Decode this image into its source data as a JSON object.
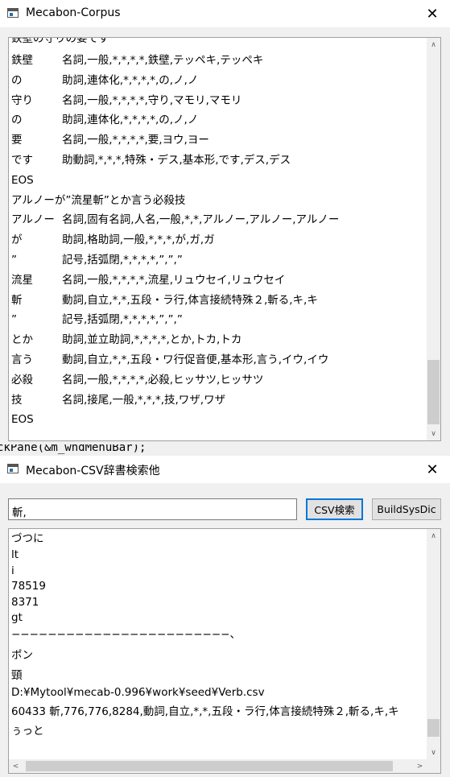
{
  "window1": {
    "title": "Mecabon-Corpus",
    "close_glyph": "✕",
    "first_line_partial": "鉄壁の守りの要です",
    "rows": [
      {
        "word": "鉄壁",
        "info": "名詞,一般,*,*,*,*,鉄壁,テッペキ,テッペキ"
      },
      {
        "word": "の",
        "info": "助詞,連体化,*,*,*,*,の,ノ,ノ"
      },
      {
        "word": "守り",
        "info": "名詞,一般,*,*,*,*,守り,マモリ,マモリ"
      },
      {
        "word": "の",
        "info": "助詞,連体化,*,*,*,*,の,ノ,ノ"
      },
      {
        "word": "要",
        "info": "名詞,一般,*,*,*,*,要,ヨウ,ヨー"
      },
      {
        "word": "です",
        "info": "助動詞,*,*,*,特殊・デス,基本形,です,デス,デス"
      },
      {
        "word": "EOS",
        "info": ""
      },
      {
        "word": "アルノーが”流星斬”とか言う必殺技",
        "info": ""
      },
      {
        "word": "アルノー",
        "info": "名詞,固有名詞,人名,一般,*,*,アルノー,アルノー,アルノー"
      },
      {
        "word": "が",
        "info": "助詞,格助詞,一般,*,*,*,が,ガ,ガ"
      },
      {
        "word": "”",
        "info": "記号,括弧閉,*,*,*,*,”,”,”"
      },
      {
        "word": "流星",
        "info": "名詞,一般,*,*,*,*,流星,リュウセイ,リュウセイ"
      },
      {
        "word": "斬",
        "info": "動詞,自立,*,*,五段・ラ行,体言接続特殊２,斬る,キ,キ"
      },
      {
        "word": "”",
        "info": "記号,括弧閉,*,*,*,*,”,”,”"
      },
      {
        "word": "とか",
        "info": "助詞,並立助詞,*,*,*,*,とか,トカ,トカ"
      },
      {
        "word": "言う",
        "info": "動詞,自立,*,*,五段・ワ行促音便,基本形,言う,イウ,イウ"
      },
      {
        "word": "必殺",
        "info": "名詞,一般,*,*,*,*,必殺,ヒッサツ,ヒッサツ"
      },
      {
        "word": "技",
        "info": "名詞,接尾,一般,*,*,*,技,ワザ,ワザ"
      },
      {
        "word": "EOS",
        "info": ""
      }
    ]
  },
  "background_code": "ckPane(&m_wndMenuBar);",
  "window2": {
    "title": "Mecabon-CSV辞書検索他",
    "close_glyph": "✕",
    "search_value": "斬,",
    "csv_search_label": "CSV検索",
    "build_label": "BuildSysDic",
    "lines": [
      "づつに",
      "lt",
      "i",
      "78519",
      "8371",
      "gt",
      "−−−−−−−−−−−−−−−−−−−−−−−−、",
      "ポン",
      "頸",
      "D:¥Mytool¥mecab-0.996¥work¥seed¥Verb.csv",
      "60433 斬,776,776,8284,動詞,自立,*,*,五段・ラ行,体言接続特殊２,斬る,キ,キ",
      "ぅっと"
    ]
  },
  "scroll_glyphs": {
    "up": "∧",
    "down": "∨",
    "left": "<",
    "right": ">"
  },
  "colors": {
    "accent": "#0078d7",
    "border": "#a0a0a0",
    "thumb": "#cdcdcd"
  }
}
